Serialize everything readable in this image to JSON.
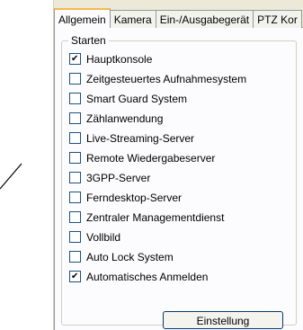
{
  "tabs": [
    {
      "label": "Allgemein",
      "active": true
    },
    {
      "label": "Kamera",
      "active": false
    },
    {
      "label": "Ein-/Ausgabegerät",
      "active": false
    },
    {
      "label": "PTZ Kor",
      "active": false
    }
  ],
  "group": {
    "legend": "Starten",
    "options": [
      {
        "label": "Hauptkonsole",
        "checked": true
      },
      {
        "label": "Zeitgesteuertes Aufnahmesystem",
        "checked": false
      },
      {
        "label": "Smart Guard System",
        "checked": false
      },
      {
        "label": "Zählanwendung",
        "checked": false
      },
      {
        "label": "Live-Streaming-Server",
        "checked": false
      },
      {
        "label": "Remote Wiedergabeserver",
        "checked": false
      },
      {
        "label": "3GPP-Server",
        "checked": false
      },
      {
        "label": "Ferndesktop-Server",
        "checked": false
      },
      {
        "label": "Zentraler Managementdienst",
        "checked": false
      },
      {
        "label": "Vollbild",
        "checked": false
      },
      {
        "label": "Auto Lock System",
        "checked": false
      },
      {
        "label": "Automatisches Anmelden",
        "checked": true
      }
    ]
  },
  "button": {
    "label": "Einstellung"
  },
  "colors": {
    "dialog_bg": "#ece9d8",
    "panel_bg": "#fcfcfe",
    "active_tab_accent": "#f6b94e",
    "checkbox_border": "#1c5180"
  }
}
